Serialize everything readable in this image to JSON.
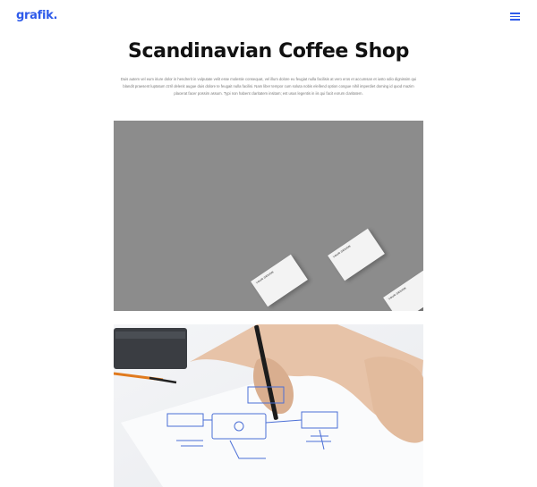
{
  "header": {
    "logo": "grafik.",
    "menu_icon": "hamburger-menu-icon"
  },
  "project": {
    "title": "Scandinavian Coffee Shop",
    "description": "Duis autem vel eum iriure dolor in hendrerit in vulputate velit esse molestie consequat, vel illum dolore eu feugiat nulla facilisis at vero eros et accumsan et iusto odio dignissim qui blandit praesent luptatum zzril delenit augue duis dolore te feugait nulla facilisi. Nam liber tempor cum soluta nobis eleifend option congue nihil imperdiet doming id quod mazim placerat facer possim assum. Typi non habent claritatem insitam; est usus legentis in iis qui facit eorum claritatem."
  },
  "gallery": {
    "business_cards": {
      "card_text": "YOUR DESIGN"
    }
  },
  "colors": {
    "accent": "#2f5bea",
    "title": "#111111",
    "body_text": "#777777",
    "card_background": "#8c8c8c"
  }
}
